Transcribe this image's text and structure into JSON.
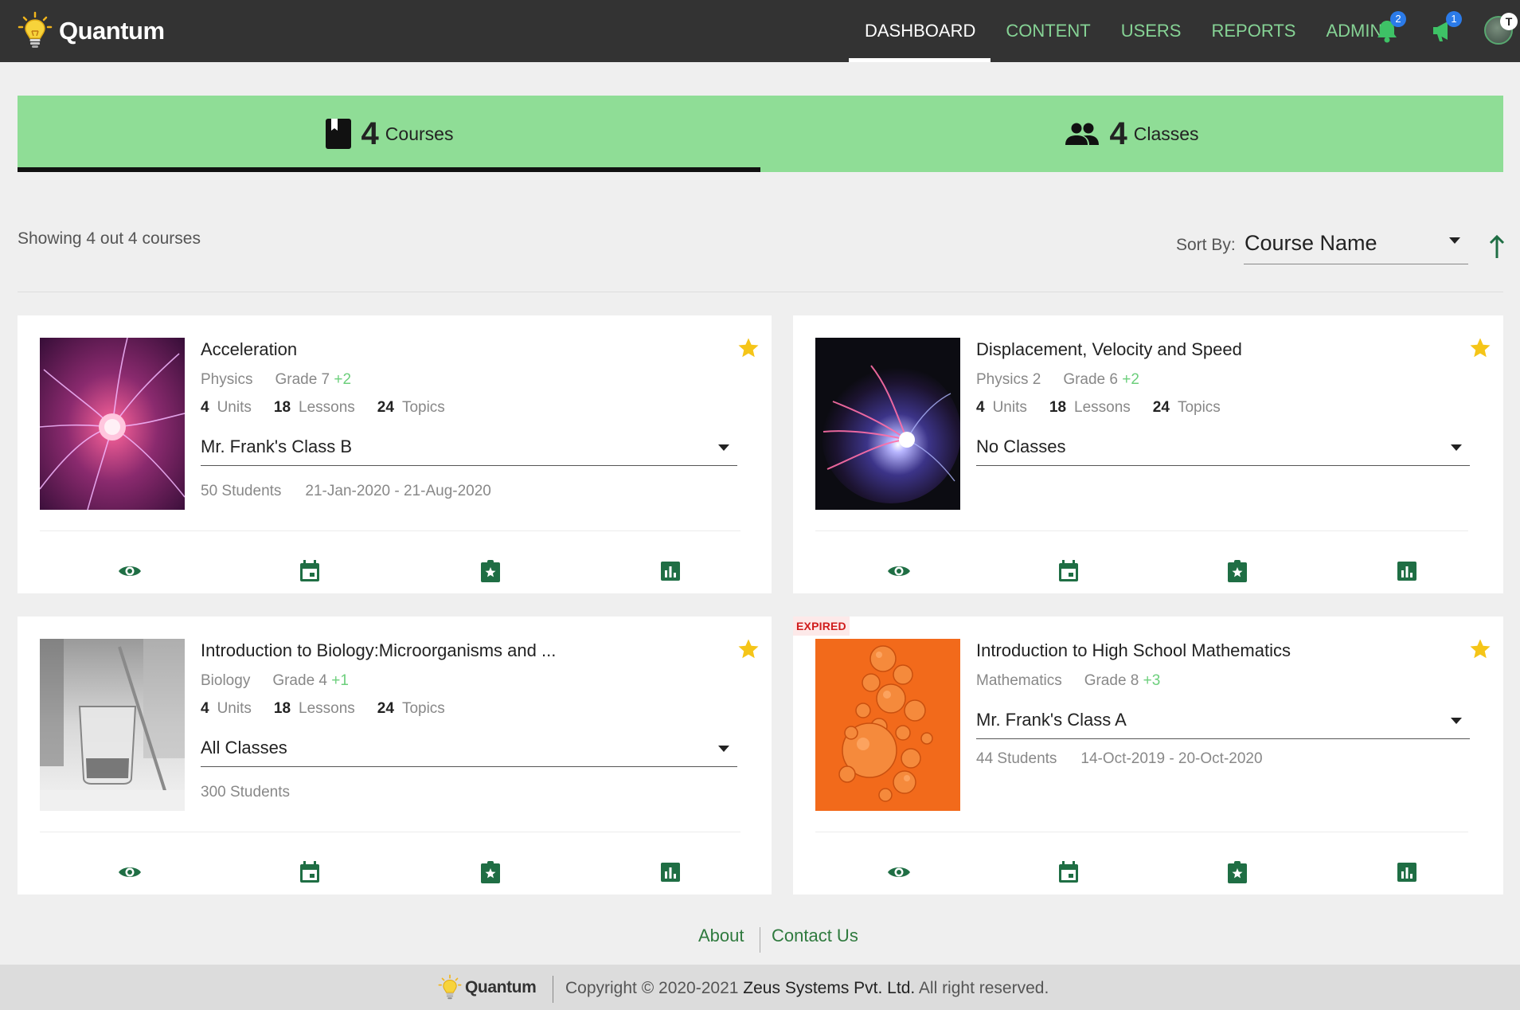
{
  "app": {
    "name": "Quantum"
  },
  "nav": {
    "items": [
      {
        "label": "DASHBOARD",
        "active": true
      },
      {
        "label": "CONTENT"
      },
      {
        "label": "USERS"
      },
      {
        "label": "REPORTS"
      },
      {
        "label": "ADMIN"
      }
    ],
    "notifications_badge": "2",
    "announcements_badge": "1",
    "avatar_badge": "T"
  },
  "tabs": [
    {
      "count": "4",
      "label": "Courses",
      "icon": "book-icon",
      "active": true
    },
    {
      "count": "4",
      "label": "Classes",
      "icon": "people-icon"
    }
  ],
  "toolbar": {
    "showing_text": "Showing 4 out 4 courses",
    "sort_label": "Sort By:",
    "sort_value": "Course Name"
  },
  "courses": [
    {
      "title": "Acceleration",
      "subject": "Physics",
      "grade": "Grade 7",
      "grade_extra": "+2",
      "units": "4",
      "units_label": "Units",
      "lessons": "18",
      "lessons_label": "Lessons",
      "topics": "24",
      "topics_label": "Topics",
      "class_select": "Mr. Frank's Class B",
      "students": "50 Students",
      "dates": "21-Jan-2020 - 21-Aug-2020",
      "starred": true,
      "image": "plasma-magenta"
    },
    {
      "title": "Displacement, Velocity and Speed",
      "subject": "Physics 2",
      "grade": "Grade 6",
      "grade_extra": "+2",
      "units": "4",
      "units_label": "Units",
      "lessons": "18",
      "lessons_label": "Lessons",
      "topics": "24",
      "topics_label": "Topics",
      "class_select": "No Classes",
      "students": "",
      "dates": "",
      "starred": true,
      "image": "plasma-globe"
    },
    {
      "title": "Introduction to Biology:Microorganisms and ...",
      "subject": "Biology",
      "grade": "Grade 4",
      "grade_extra": "+1",
      "units": "4",
      "units_label": "Units",
      "lessons": "18",
      "lessons_label": "Lessons",
      "topics": "24",
      "topics_label": "Topics",
      "class_select": "All Classes",
      "students": "300 Students",
      "dates": "",
      "starred": true,
      "image": "lab-glassware"
    },
    {
      "title": "Introduction to High School Mathematics",
      "subject": "Mathematics",
      "grade": "Grade 8",
      "grade_extra": "+3",
      "units": "",
      "units_label": "",
      "lessons": "",
      "lessons_label": "",
      "topics": "",
      "topics_label": "",
      "class_select": "Mr. Frank's Class A",
      "students": "44 Students",
      "dates": "14-Oct-2019 - 20-Oct-2020",
      "starred": true,
      "expired_label": "EXPIRED",
      "image": "orange-bubbles"
    }
  ],
  "card_actions": [
    "eye-icon",
    "calendar-icon",
    "assignment-star-icon",
    "bar-chart-icon"
  ],
  "footer": {
    "about": "About",
    "contact": "Contact Us",
    "brand": "Quantum",
    "copyright_prefix": "Copyright © 2020-2021",
    "company": "Zeus Systems Pvt. Ltd.",
    "rights": "All right reserved."
  },
  "colors": {
    "topbar": "#333333",
    "nav_green": "#86d395",
    "tab_bg": "#8fdd96",
    "icon_green": "#1f6e44",
    "star": "#f5c518",
    "expired": "#d01c1c"
  }
}
